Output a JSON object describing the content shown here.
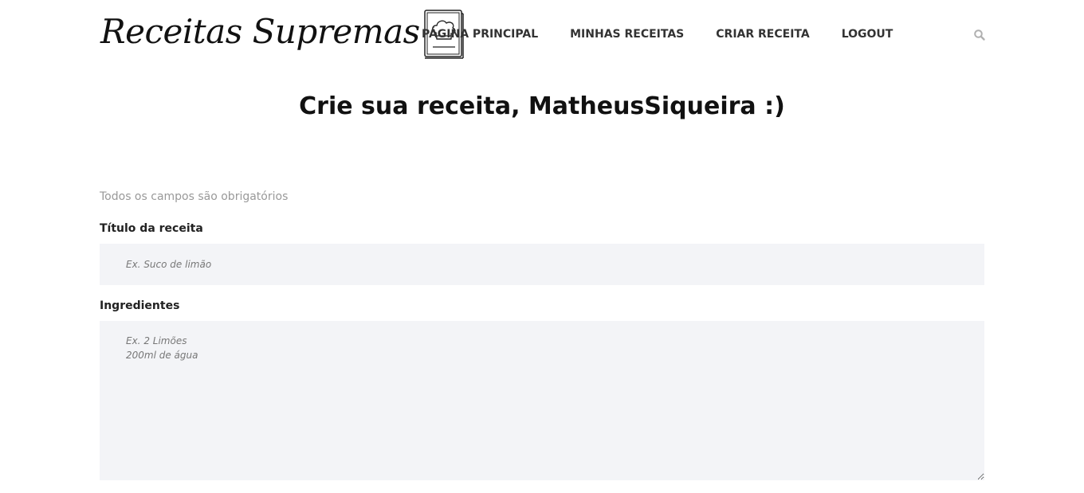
{
  "brand": {
    "name": "Receitas Supremas",
    "logo_icon": "chef-hat-book-icon"
  },
  "nav": {
    "items": [
      {
        "label": "PÁGINA PRINCIPAL"
      },
      {
        "label": "MINHAS RECEITAS"
      },
      {
        "label": "CRIAR RECEITA"
      },
      {
        "label": "LOGOUT"
      }
    ],
    "search_icon": "search-icon"
  },
  "main": {
    "title": "Crie sua receita, MatheusSiqueira :)",
    "hint": "Todos os campos são obrigatórios",
    "fields": {
      "title": {
        "label": "Título da receita",
        "value": "",
        "placeholder": "Ex. Suco de limão"
      },
      "ingredients": {
        "label": "Ingredientes",
        "value": "",
        "placeholder": "Ex. 2 Limões\n200ml de água"
      }
    }
  },
  "colors": {
    "field_background": "#f3f4f7",
    "hint_text": "#999999",
    "nav_text": "#333333"
  }
}
